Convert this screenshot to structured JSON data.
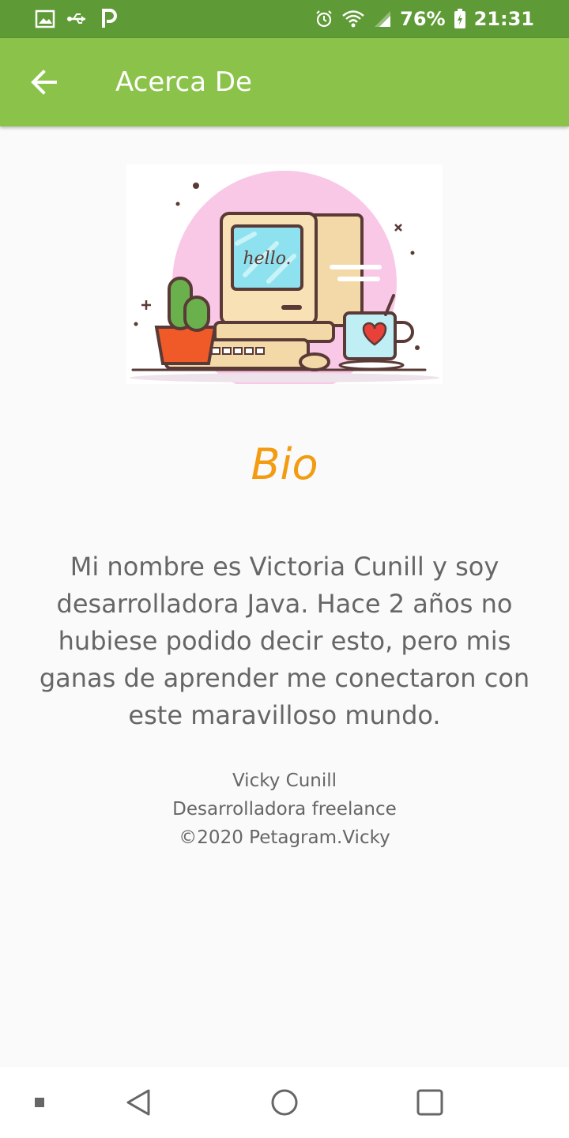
{
  "status_bar": {
    "battery": "76%",
    "time": "21:31",
    "left_icons": [
      "image-icon",
      "usb-icon",
      "parking-icon"
    ],
    "right_icons": [
      "alarm-icon",
      "wifi-icon",
      "signal-icon",
      "battery-icon"
    ]
  },
  "app_bar": {
    "title": "Acerca De",
    "back_icon": "arrow-back-icon",
    "color": "#8bc34a"
  },
  "hero": {
    "screen_text": "hello."
  },
  "bio": {
    "title": "Bio",
    "text": "Mi nombre es Victoria Cunill y soy desarrolladora Java. Hace 2 años no hubiese podido decir esto, pero mis ganas de aprender me conectaron con este maravilloso mundo.",
    "title_color": "#f39c12"
  },
  "credits": {
    "name": "Vicky Cunill",
    "role": "Desarrolladora freelance",
    "copyright": "©2020 Petagram.Vicky"
  },
  "nav_bar": {
    "icons": [
      "menu-dot-icon",
      "back-triangle-icon",
      "home-circle-icon",
      "recents-square-icon"
    ]
  }
}
